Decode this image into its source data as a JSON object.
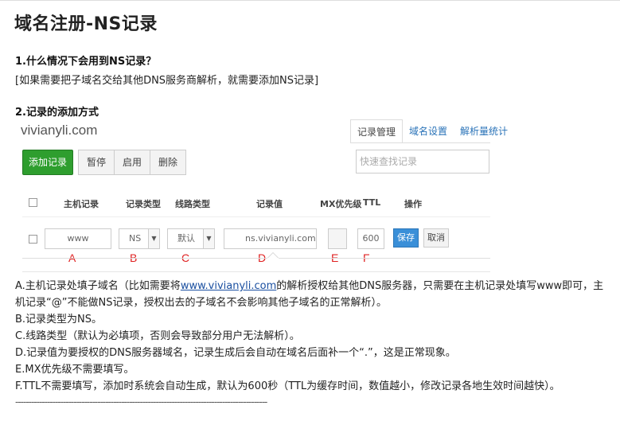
{
  "title": "域名注册-NS记录",
  "q1": {
    "heading": "1.什么情况下会用到NS记录？",
    "answer": "[如果需要把子域名交给其他DNS服务商解析，就需要添加NS记录]"
  },
  "q2": {
    "heading": "2.记录的添加方式"
  },
  "panel": {
    "domain": "vivianyli.com",
    "tabs": [
      "记录管理",
      "域名设置",
      "解析量统计"
    ],
    "add_button": "添加记录",
    "buttons": [
      "暂停",
      "启用",
      "删除"
    ],
    "search_placeholder": "快速查找记录",
    "columns": [
      "主机记录",
      "记录类型",
      "线路类型",
      "记录值",
      "MX优先级",
      "TTL",
      "操作"
    ],
    "row": {
      "host": "www",
      "type": "NS",
      "line": "默认",
      "value": "ns.vivianyli.com",
      "mx": "",
      "ttl": "600",
      "save": "保存",
      "cancel": "取消"
    },
    "markers": [
      "A",
      "B",
      "C",
      "D",
      "E",
      "F"
    ]
  },
  "notes": {
    "a_prefix": "A.主机记录处填子域名（比如需要将",
    "a_link": "www.vivianyli.com",
    "a_suffix": "的解析授权给其他DNS服务器，只需要在主机记录处填写www即可，主机记录“@”不能做NS记录，授权出去的子域名不会影响其他子域名的正常解析）。",
    "b": "B.记录类型为NS。",
    "c": "C.线路类型（默认为必填项，否则会导致部分用户无法解析）。",
    "d": "D.记录值为要授权的DNS服务器域名，记录生成后会自动在域名后面补一个“.”，这是正常现象。",
    "e": "E.MX优先级不需要填写。",
    "f": "F.TTL不需要填写，添加时系统会自动生成，默认为600秒（TTL为缓存时间，数值越小，修改记录各地生效时间越快）。"
  },
  "divider": "-----------------------------------------------------------------------------------------------"
}
